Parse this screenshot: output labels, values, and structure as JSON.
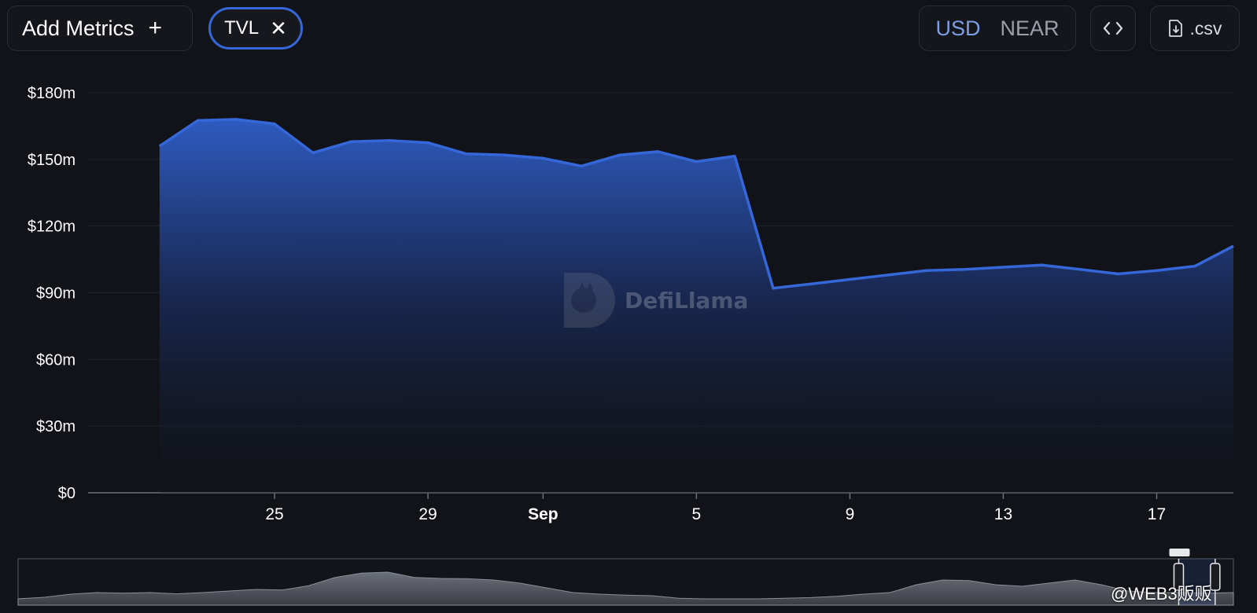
{
  "toolbar": {
    "add_metrics_label": "Add Metrics",
    "add_icon": "+",
    "metric_chip_label": "TVL",
    "metric_chip_close": "✕",
    "currency_options": [
      "USD",
      "NEAR"
    ],
    "selected_currency": "USD",
    "embed_icon": "code-icon",
    "csv_label": ".csv",
    "csv_icon": "file-download-icon"
  },
  "colors": {
    "background": "#111318",
    "line": "#3567d8",
    "accent_text": "#7c9ee8"
  },
  "watermark": {
    "text": "DefiLlama"
  },
  "corner_mark": {
    "text": "@WEB3贩贩"
  },
  "chart_data": {
    "type": "area",
    "title": "",
    "xlabel": "",
    "ylabel": "",
    "ylim": [
      0,
      180
    ],
    "yticks": [
      {
        "value": 0,
        "label": "$0"
      },
      {
        "value": 30,
        "label": "$30m"
      },
      {
        "value": 60,
        "label": "$60m"
      },
      {
        "value": 90,
        "label": "$90m"
      },
      {
        "value": 120,
        "label": "$120m"
      },
      {
        "value": 150,
        "label": "$150m"
      },
      {
        "value": 180,
        "label": "$180m"
      }
    ],
    "xticks": [
      {
        "label": "25",
        "date": "2023-08-25",
        "bold": false
      },
      {
        "label": "29",
        "date": "2023-08-29",
        "bold": false
      },
      {
        "label": "Sep",
        "date": "2023-09-01",
        "bold": true
      },
      {
        "label": "5",
        "date": "2023-09-05",
        "bold": false
      },
      {
        "label": "9",
        "date": "2023-09-09",
        "bold": false
      },
      {
        "label": "13",
        "date": "2023-09-13",
        "bold": false
      },
      {
        "label": "17",
        "date": "2023-09-17",
        "bold": false
      }
    ],
    "xlim": [
      "2023-08-21",
      "2023-09-19"
    ],
    "grid": true,
    "series": [
      {
        "points": [
          {
            "x": "2023-08-22",
            "y": 156
          },
          {
            "x": "2023-08-23",
            "y": 167.5
          },
          {
            "x": "2023-08-24",
            "y": 168
          },
          {
            "x": "2023-08-25",
            "y": 166
          },
          {
            "x": "2023-08-26",
            "y": 153
          },
          {
            "x": "2023-08-27",
            "y": 158
          },
          {
            "x": "2023-08-28",
            "y": 158.5
          },
          {
            "x": "2023-08-29",
            "y": 157.5
          },
          {
            "x": "2023-08-30",
            "y": 152.5
          },
          {
            "x": "2023-08-31",
            "y": 152
          },
          {
            "x": "2023-09-01",
            "y": 150.5
          },
          {
            "x": "2023-09-02",
            "y": 147
          },
          {
            "x": "2023-09-03",
            "y": 152
          },
          {
            "x": "2023-09-04",
            "y": 153.5
          },
          {
            "x": "2023-09-05",
            "y": 149
          },
          {
            "x": "2023-09-06",
            "y": 151.5
          },
          {
            "x": "2023-09-07",
            "y": 92
          },
          {
            "x": "2023-09-08",
            "y": 94
          },
          {
            "x": "2023-09-09",
            "y": 96
          },
          {
            "x": "2023-09-10",
            "y": 98
          },
          {
            "x": "2023-09-11",
            "y": 100
          },
          {
            "x": "2023-09-12",
            "y": 100.5
          },
          {
            "x": "2023-09-13",
            "y": 101.5
          },
          {
            "x": "2023-09-14",
            "y": 102.5
          },
          {
            "x": "2023-09-15",
            "y": 100.5
          },
          {
            "x": "2023-09-16",
            "y": 98.5
          },
          {
            "x": "2023-09-17",
            "y": 100
          },
          {
            "x": "2023-09-18",
            "y": 102
          },
          {
            "x": "2023-09-19",
            "y": 111
          }
        ]
      }
    ],
    "brush_overview": {
      "selection": [
        0.955,
        0.985
      ],
      "profile": [
        0.1,
        0.15,
        0.25,
        0.3,
        0.28,
        0.3,
        0.26,
        0.3,
        0.35,
        0.4,
        0.38,
        0.52,
        0.78,
        0.92,
        0.95,
        0.78,
        0.75,
        0.74,
        0.7,
        0.6,
        0.45,
        0.3,
        0.25,
        0.22,
        0.2,
        0.12,
        0.1,
        0.1,
        0.1,
        0.12,
        0.14,
        0.18,
        0.25,
        0.3,
        0.55,
        0.7,
        0.68,
        0.55,
        0.5,
        0.6,
        0.7,
        0.55,
        0.35,
        0.3,
        0.3,
        0.28,
        0.3
      ]
    }
  }
}
